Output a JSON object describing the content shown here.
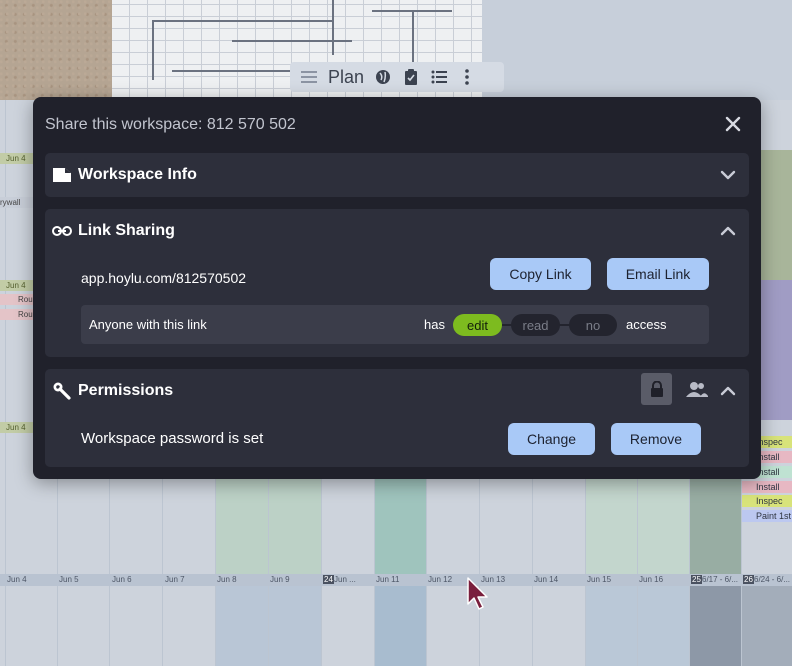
{
  "modal": {
    "title": "Share this workspace: 812 570 502",
    "sections": {
      "workspace_info": {
        "title": "Workspace Info",
        "expanded": false
      },
      "link_sharing": {
        "title": "Link Sharing",
        "expanded": true,
        "url": "app.hoylu.com/812570502",
        "copy_label": "Copy Link",
        "email_label": "Email Link",
        "access_label": "Anyone with this link",
        "has_label": "has",
        "access_word": "access",
        "permissions": [
          {
            "label": "edit",
            "selected": true
          },
          {
            "label": "read",
            "selected": false
          },
          {
            "label": "no",
            "selected": false
          }
        ]
      },
      "permissions": {
        "title": "Permissions",
        "expanded": true,
        "status": "Workspace password is set",
        "change_label": "Change",
        "remove_label": "Remove"
      }
    }
  },
  "toolbar": {
    "plan_label": "Plan"
  },
  "calendar": {
    "dates": [
      "Jun 4",
      "Jun 5",
      "Jun 6",
      "Jun 7",
      "Jun 8",
      "Jun 9",
      "Jun ...",
      "Jun 11",
      "Jun 12",
      "Jun 13",
      "Jun 14",
      "Jun 15",
      "Jun 16",
      "6/17 - 6/...",
      "6/24 - 6/..."
    ],
    "week_badges": [
      "24",
      "25",
      "26"
    ],
    "left_labels": {
      "date": "Jun 4",
      "drywall": "rywall",
      "rough": "Rou"
    },
    "right_tags": [
      "Inspec",
      "Install",
      "Install",
      "Install",
      "Inspec",
      "Paint 1st"
    ]
  },
  "colors": {
    "modal_bg": "#20212b",
    "section_bg": "#2d2f3b",
    "button_bg": "#a9c9f7",
    "edit_active": "#7dbb1f"
  }
}
